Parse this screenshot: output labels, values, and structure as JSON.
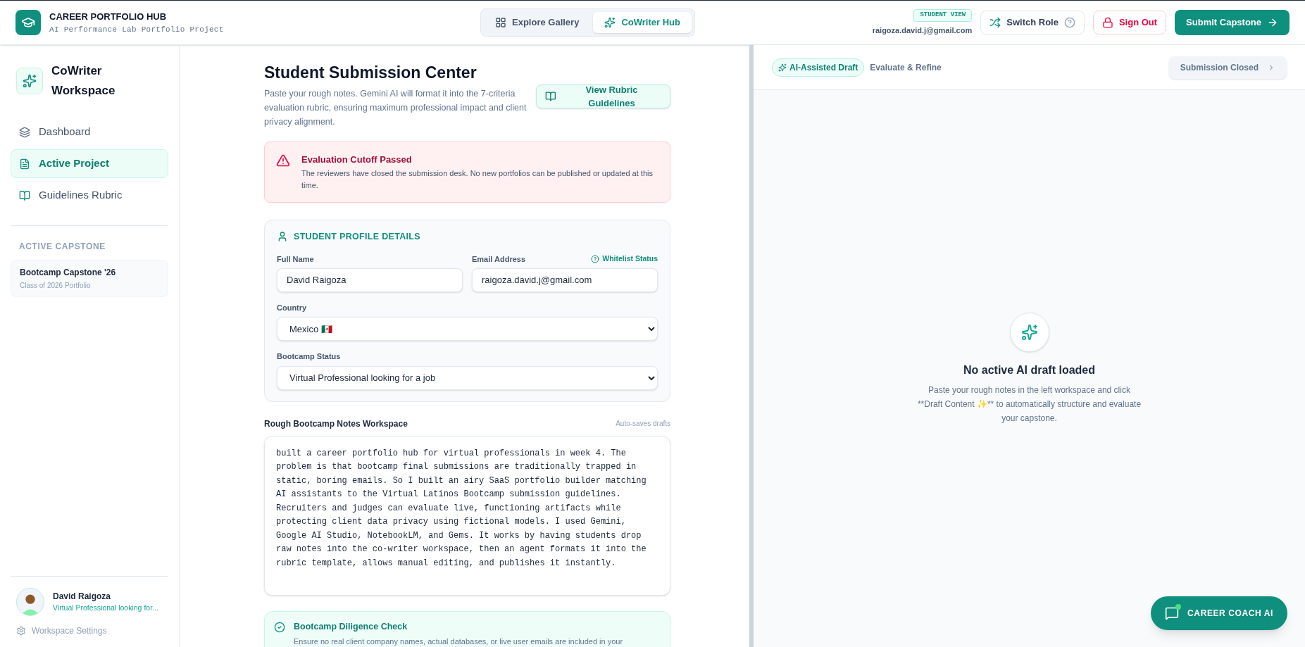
{
  "header": {
    "title": "CAREER PORTFOLIO HUB",
    "subtitle": "AI Performance Lab Portfolio Project",
    "tabs": [
      {
        "label": "Explore Gallery",
        "selected": false,
        "kind": "grid"
      },
      {
        "label": "CoWriter Hub",
        "selected": true,
        "kind": "sparkles"
      }
    ],
    "role_badge": "STUDENT VIEW",
    "email": "raigoza.david.j@gmail.com",
    "switch_role": "Switch Role",
    "sign_out": "Sign Out",
    "submit": "Submit Capstone"
  },
  "sidebar": {
    "title": "CoWriter Workspace",
    "items": [
      {
        "label": "Dashboard",
        "selected": false,
        "kind": "layers"
      },
      {
        "label": "Active Project",
        "selected": true,
        "kind": "file"
      },
      {
        "label": "Guidelines Rubric",
        "selected": false,
        "kind": "book"
      }
    ],
    "section_heading": "ACTIVE CAPSTONE",
    "capstone": {
      "title": "Bootcamp Capstone '26",
      "subtitle": "Class of 2026 Portfolio"
    },
    "user": {
      "name": "David Raigoza",
      "status": "Virtual Professional looking for..."
    },
    "settings": "Workspace Settings"
  },
  "main": {
    "title": "Student Submission Center",
    "description": "Paste your rough notes. Gemini AI will format it into the 7-criteria evaluation rubric, ensuring maximum professional impact and client privacy alignment.",
    "rubric_button": "View Rubric Guidelines",
    "alert": {
      "title": "Evaluation Cutoff Passed",
      "message": "The reviewers have closed the submission desk. No new portfolios can be published or updated at this time."
    },
    "profile": {
      "heading": "STUDENT PROFILE DETAILS",
      "full_name_label": "Full Name",
      "full_name": "David Raigoza",
      "email_label": "Email Address",
      "whitelist": "Whitelist Status",
      "email": "raigoza.david.j@gmail.com",
      "country_label": "Country",
      "country": "Mexico 🇲🇽",
      "status_label": "Bootcamp Status",
      "status": "Virtual Professional looking for a job"
    },
    "notes": {
      "label": "Rough Bootcamp Notes Workspace",
      "hint": "Auto-saves drafts",
      "value": "built a career portfolio hub for virtual professionals in week 4. The problem is that bootcamp final submissions are traditionally trapped in static, boring emails. So I built an airy SaaS portfolio builder matching AI assistants to the Virtual Latinos Bootcamp submission guidelines. Recruiters and judges can evaluate live, functioning artifacts while protecting client data privacy using fictional models. I used Gemini, Google AI Studio, NotebookLM, and Gems. It works by having students drop raw notes into the co-writer workspace, then an agent formats it into the rubric template, allows manual editing, and publishes it instantly."
    },
    "check": {
      "title": "Bootcamp Diligence Check",
      "message": "Ensure no real client company names, actual databases, or live user emails are included in your"
    }
  },
  "draft": {
    "badge": "AI-Assisted Draft",
    "subtitle": "Evaluate & Refine",
    "closed_button": "Submission Closed",
    "closed_disabled": true,
    "empty_title": "No active AI draft loaded",
    "empty_message": "Paste your rough notes in the left workspace and click **Draft Content ✨** to automatically structure and evaluate your capstone."
  },
  "coach_button": "CAREER COACH AI"
}
